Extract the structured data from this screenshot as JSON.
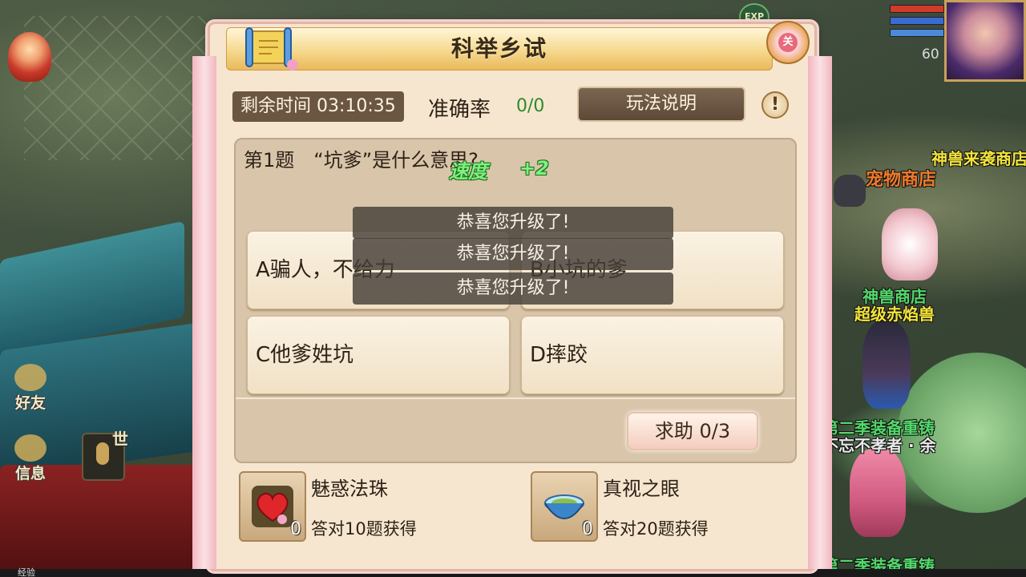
{
  "hud": {
    "exp_badge": "EXP",
    "level": "60",
    "side_buttons": [
      {
        "label": "好友"
      },
      {
        "label": "信息"
      }
    ],
    "world_channel": "世",
    "exp_bar_label": "经验"
  },
  "world": {
    "npc_labels": [
      {
        "text": "神兽来袭商店",
        "color": "gold"
      },
      {
        "text": "宠物商店",
        "color": "orange"
      },
      {
        "text": "神兽商店",
        "color": "green"
      },
      {
        "text": "超级赤焰兽",
        "color": "gold"
      },
      {
        "text": "第二季装备重铸",
        "color": "green"
      },
      {
        "text": "不忘不孝者 · 余",
        "color": "white"
      },
      {
        "text": "第二季装备重铸",
        "color": "green"
      }
    ]
  },
  "dialog": {
    "title": "科举乡试",
    "close_label": "关",
    "timer_label": "剩余时间 03:10:35",
    "accuracy_label": "准确率",
    "accuracy_value": "0/0",
    "rules_button": "玩法说明",
    "help_icon": "!",
    "question": {
      "number": "第1题",
      "text": "“坑爹”是什么意思?"
    },
    "options": [
      {
        "label": "A骗人，不给力"
      },
      {
        "label": "B小坑的爹"
      },
      {
        "label": "C他爹姓坑"
      },
      {
        "label": "D摔跤"
      }
    ],
    "help_button": "求助  0/3",
    "rewards": [
      {
        "name": "魅惑法珠",
        "desc": "答对10题获得",
        "count": "0",
        "icon": "heart-gem-icon"
      },
      {
        "name": "真视之眼",
        "desc": "答对20题获得",
        "count": "0",
        "icon": "bowl-eye-icon"
      }
    ]
  },
  "overlays": {
    "speed_label": "速度",
    "speed_value": "+2",
    "toasts": [
      "恭喜您升级了!",
      "恭喜您升级了!",
      "恭喜您升级了!"
    ]
  }
}
